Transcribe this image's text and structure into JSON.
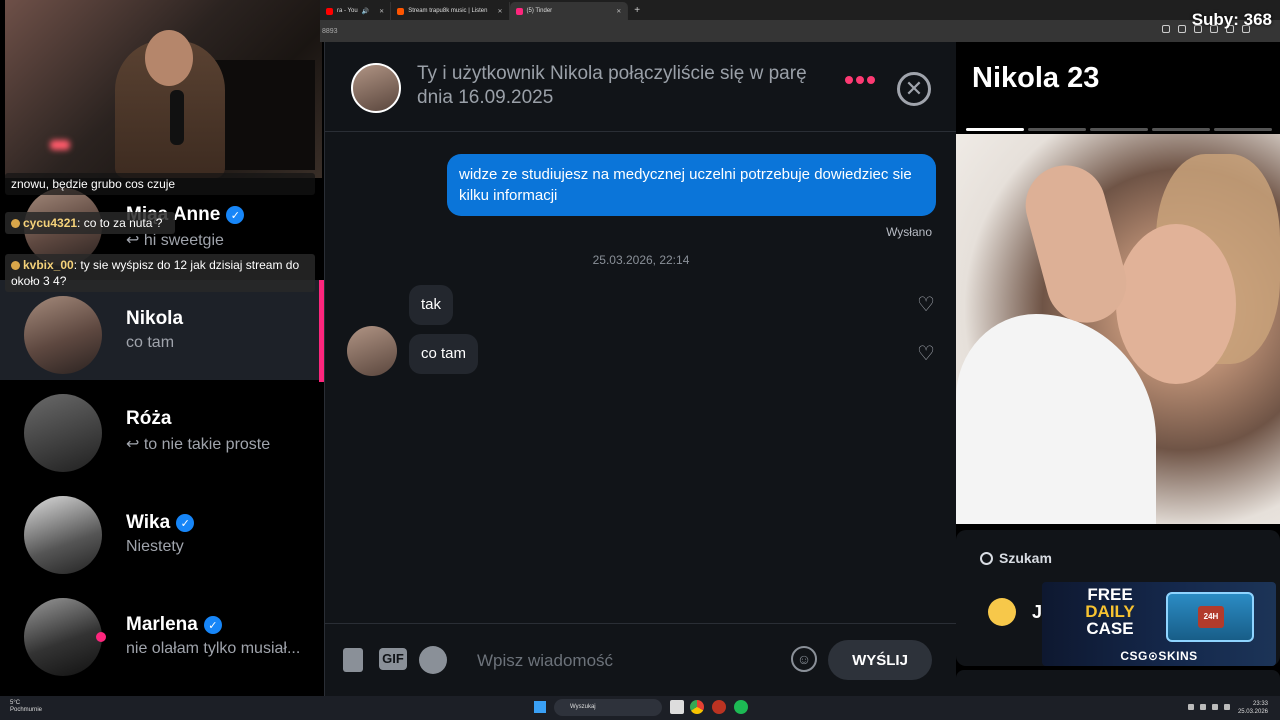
{
  "browser": {
    "tabs": [
      {
        "label": "ra - You",
        "icon_color": "#ff0000"
      },
      {
        "label": "Stream trapu8k music | Listen",
        "icon_color": "#ff5500"
      },
      {
        "label": "(5) Tinder",
        "icon_color": "#fd267d"
      }
    ],
    "address_fragment": "8893"
  },
  "overlay": {
    "subs": "Suby: 368",
    "chat": [
      {
        "user": "",
        "text": "znowu, będzie grubo cos czuje"
      },
      {
        "user": "cycu4321",
        "text": ": co to za nuta ?"
      },
      {
        "user": "kvbix_00",
        "text": ": ty sie wyśpisz do 12 jak dzisiaj stream do około 3 4?"
      }
    ],
    "promo": {
      "free": "FREE",
      "daily": "DAILY",
      "case": "CASE",
      "crate_label": "24H",
      "brand": "CSG⊙SKINS"
    }
  },
  "matches": [
    {
      "name": "Miąa Anne",
      "last": "↩ hi sweetgie",
      "verified": true
    },
    {
      "name": "Nikola",
      "last": "co tam",
      "verified": false
    },
    {
      "name": "Róża",
      "last": "↩ to nie takie proste",
      "verified": false
    },
    {
      "name": "Wika",
      "last": "Niestety",
      "verified": true
    },
    {
      "name": "Marlena",
      "last": "nie olałam tylko musiał...",
      "verified": true
    }
  ],
  "chat": {
    "header": "Ty i użytkownik Nikola połączyliście się w parę dnia 16.09.2025",
    "outgoing": "widze ze studiujesz na medycznej uczelni potrzebuje dowiedziec sie kilku informacji",
    "status": "Wysłano",
    "timestamp": "25.03.2026, 22:14",
    "incoming": [
      "tak",
      "co tam"
    ],
    "composer": {
      "gif": "GIF",
      "placeholder": "Wpisz wiadomość",
      "send": "WYŚLIJ"
    }
  },
  "profile": {
    "name_age": "Nikola 23",
    "photos_total": 5,
    "photo_index": 1,
    "searching_label": "Szukam",
    "searching_value_letter": "J"
  },
  "taskbar": {
    "weather_temp": "5°C",
    "weather_desc": "Pochmurnie",
    "search_label": "Wyszukaj",
    "time": "23:33",
    "date": "25.03.2026"
  },
  "colors": {
    "accent": "#fd267d",
    "bubble_out": "#0b75d9",
    "verified": "#1786f8"
  }
}
